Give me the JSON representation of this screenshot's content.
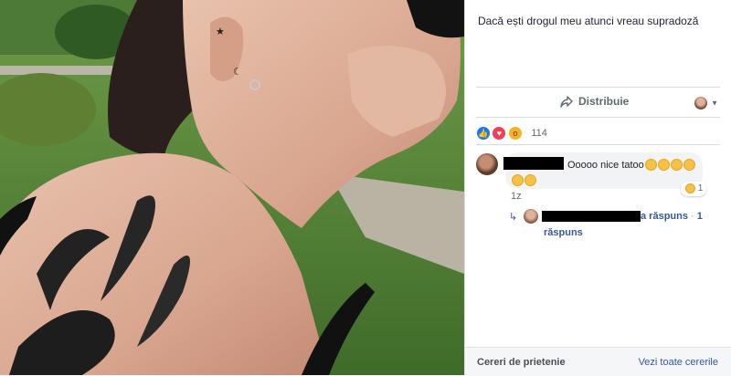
{
  "post": {
    "caption": "Dacă ești drogul meu atunci vreau supradoză"
  },
  "actions": {
    "share_label": "Distribuie"
  },
  "reactions": {
    "count": "114",
    "types": [
      "like-icon",
      "love-icon",
      "wow-icon"
    ]
  },
  "comment": {
    "text": "Ooooo nice tatoo",
    "time": "1z",
    "reaction_count": "1"
  },
  "reply": {
    "action": "a răspuns",
    "separator": "·",
    "count": "1",
    "count_label": "răspuns"
  },
  "friend_requests": {
    "title": "Cereri de prietenie",
    "see_all": "Vezi toate cererile"
  },
  "colors": {
    "like": "#1877f2",
    "love": "#f33e58",
    "wow": "#f7b125",
    "link": "#385898"
  }
}
